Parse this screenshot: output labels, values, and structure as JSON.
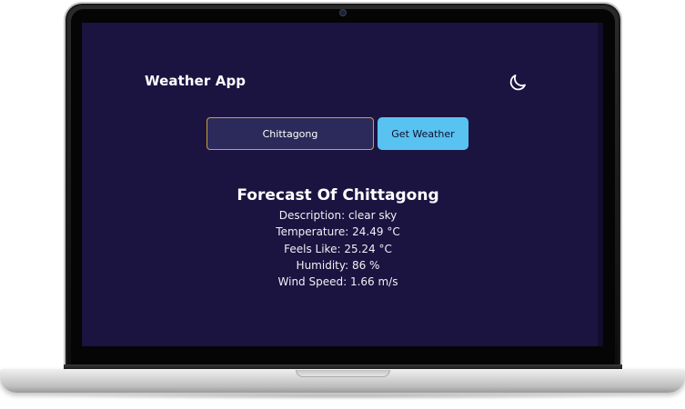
{
  "app": {
    "title": "Weather App",
    "theme_icon": "moon-icon"
  },
  "search": {
    "value": "Chittagong",
    "button_label": "Get Weather"
  },
  "forecast": {
    "title": "Forecast Of Chittagong",
    "description": "Description: clear sky",
    "temperature": "Temperature: 24.49 °C",
    "feels_like": "Feels Like: 25.24 °C",
    "humidity": "Humidity: 86 %",
    "wind_speed": "Wind Speed: 1.66 m/s"
  },
  "colors": {
    "background": "#1b1340",
    "input_background": "#2c2a5a",
    "input_border": "#c9a23c",
    "button_background": "#58c2f1",
    "text": "#ffffff"
  }
}
